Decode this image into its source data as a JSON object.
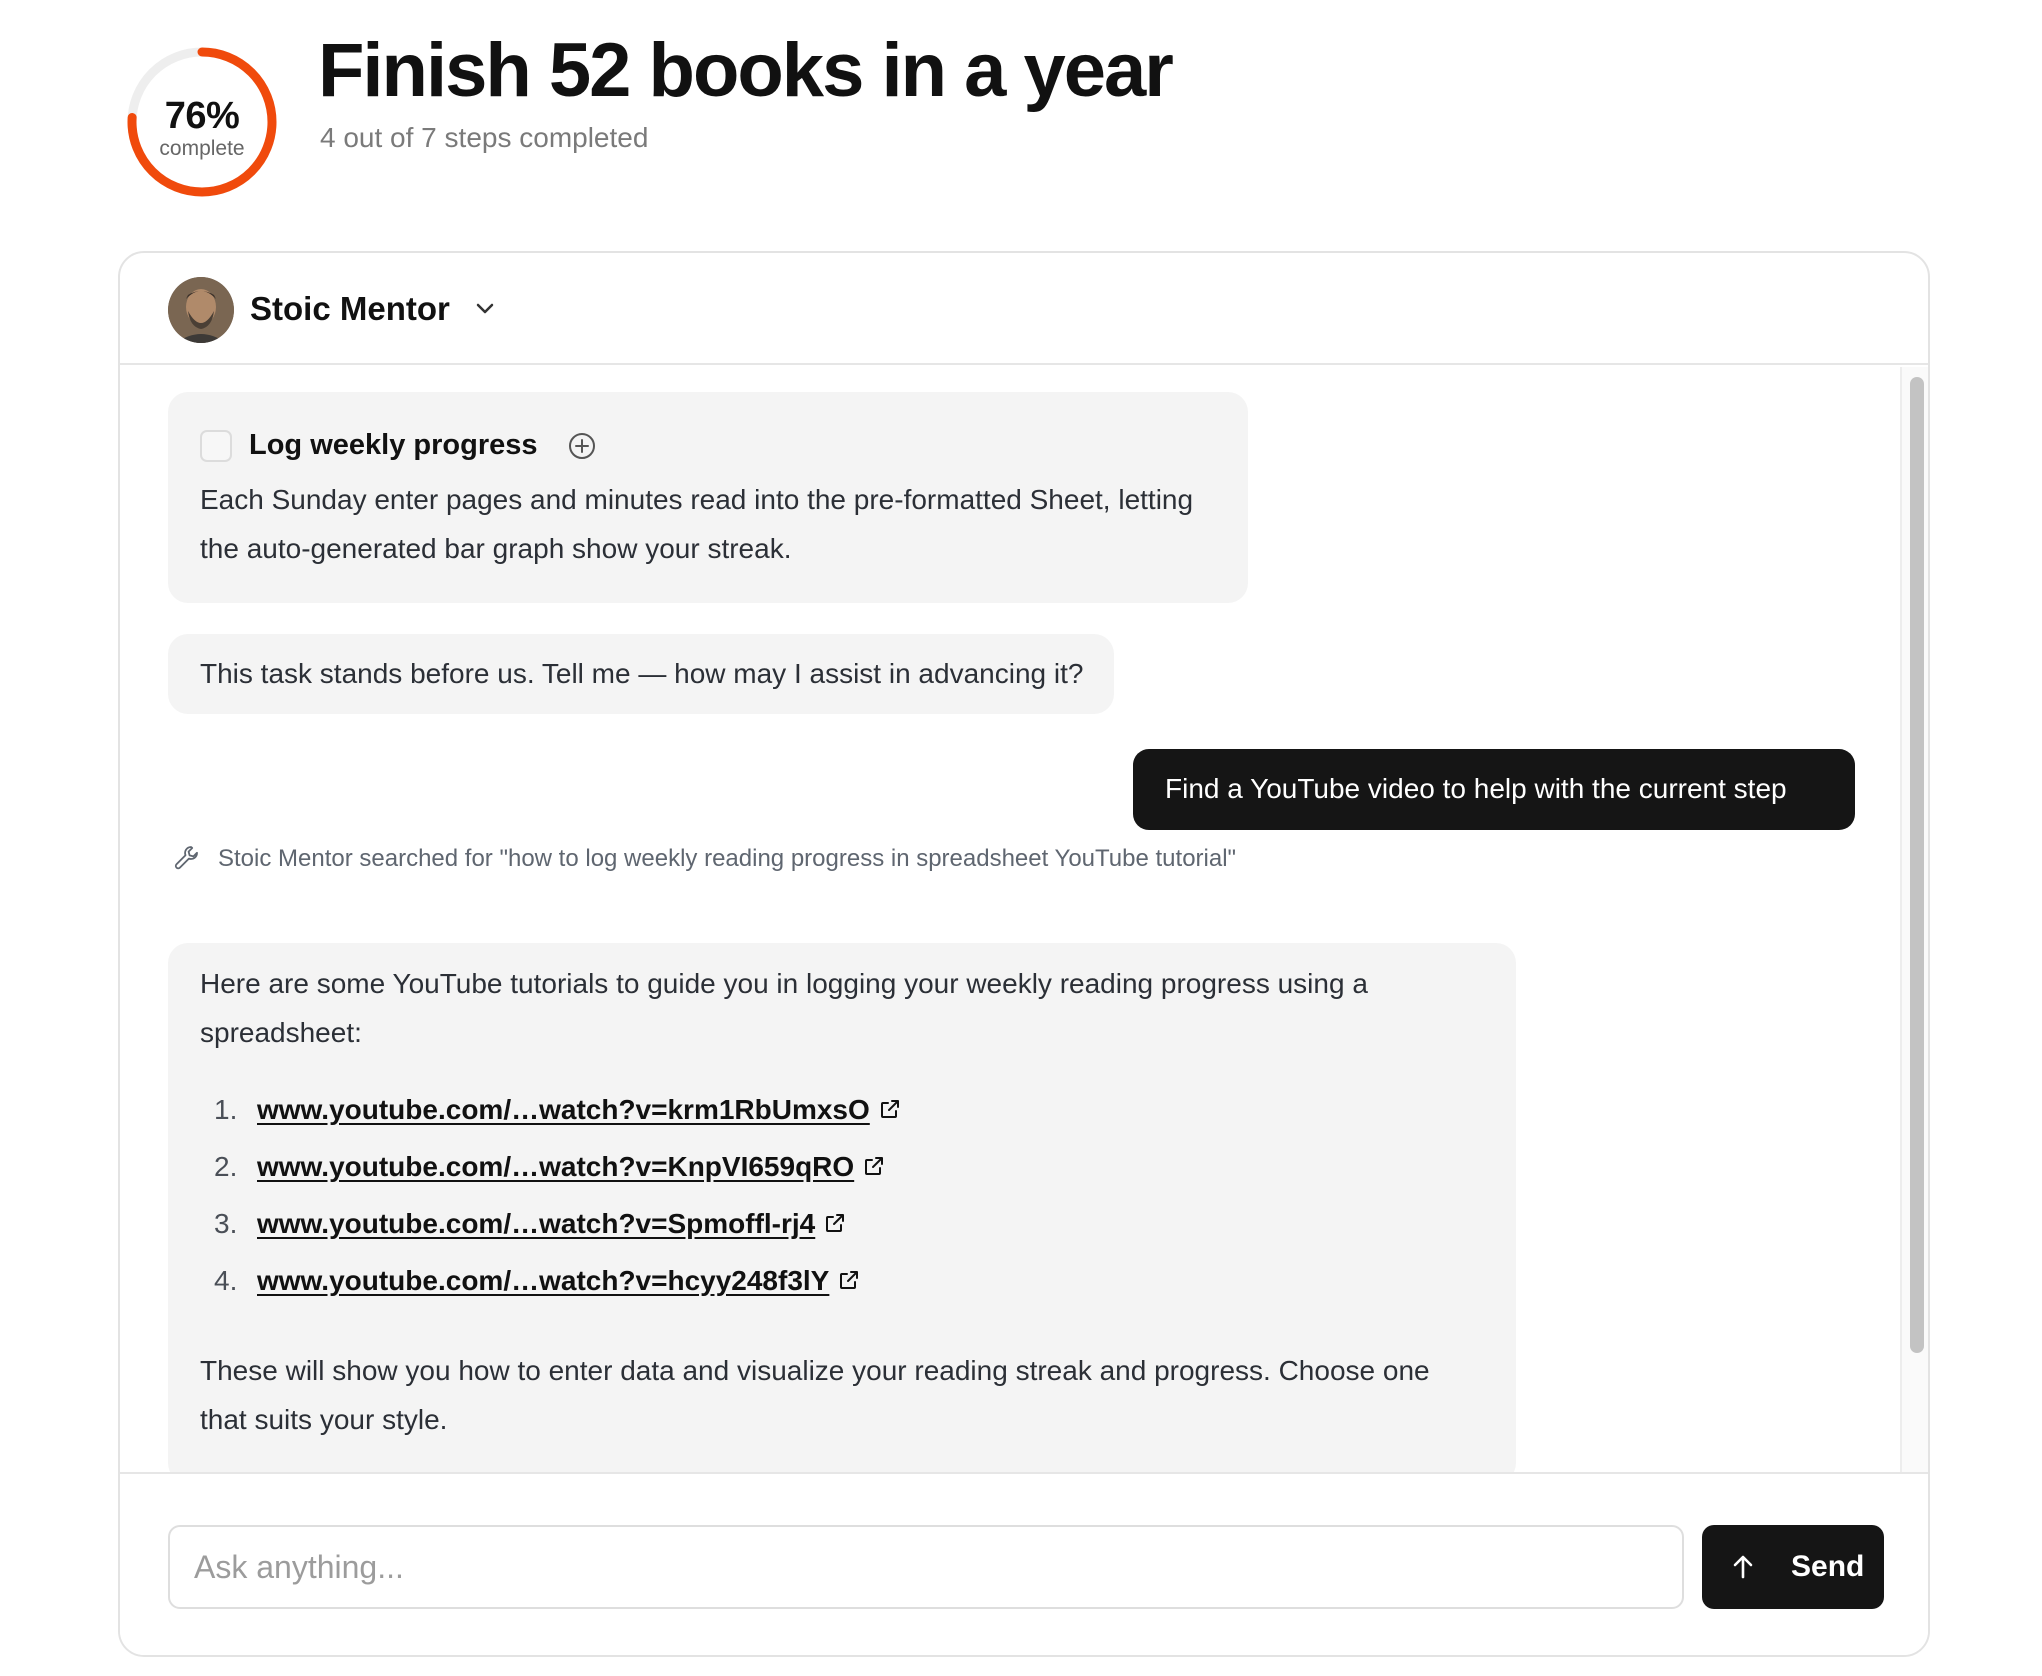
{
  "goal": {
    "title": "Finish 52 books in a year",
    "progress_fraction": 0.76,
    "progress_label": "76%",
    "progress_sub": "complete",
    "steps_text": "4 out of 7 steps completed"
  },
  "mentor": {
    "name": "Stoic Mentor",
    "avatar_icon": "mentor-avatar"
  },
  "chat": {
    "task": {
      "title": "Log weekly progress",
      "body": "Each Sunday enter pages and minutes read into the pre-formatted Sheet, letting the auto-generated bar graph show your streak."
    },
    "assistant_prompt": "This task stands before us. Tell me — how may I assist in advancing it?",
    "user_message": "Find a YouTube video to help with the current step",
    "tool_note": "Stoic Mentor searched for \"how to log weekly reading progress in spreadsheet YouTube tutorial\"",
    "reply": {
      "intro": "Here are some YouTube tutorials to guide you in logging your weekly reading progress using a spreadsheet:",
      "links": [
        {
          "num": "1.",
          "text": "www.youtube.com/…watch?v=krm1RbUmxsO"
        },
        {
          "num": "2.",
          "text": "www.youtube.com/…watch?v=KnpVI659qRO"
        },
        {
          "num": "3.",
          "text": "www.youtube.com/…watch?v=Spmoffl-rj4"
        },
        {
          "num": "4.",
          "text": "www.youtube.com/…watch?v=hcyy248f3lY"
        }
      ],
      "outro": "These will show you how to enter data and visualize your reading streak and progress. Choose one that suits your style."
    }
  },
  "composer": {
    "placeholder": "Ask anything...",
    "value": "",
    "send_label": "Send"
  },
  "colors": {
    "progress_ring": "#f04a0c",
    "ring_track": "#eeeeee",
    "dark_button": "#151515",
    "bubble_bg": "#f4f4f4"
  }
}
